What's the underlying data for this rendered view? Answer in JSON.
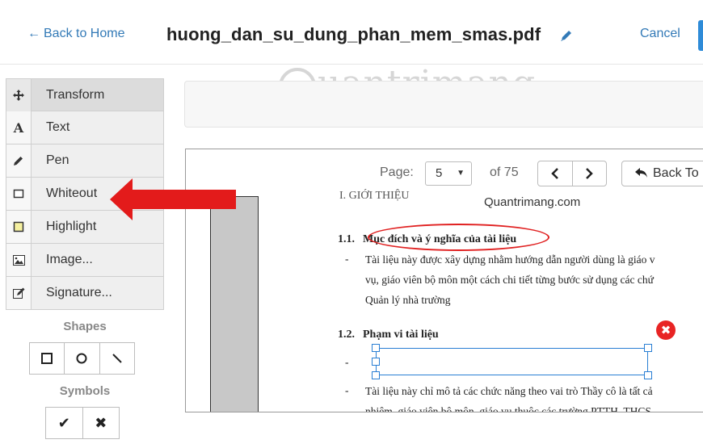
{
  "header": {
    "back_link": "Back to Home",
    "back_arrow": "←",
    "file_name": "huong_dan_su_dung_phan_mem_smas.pdf",
    "cancel": "Cancel",
    "edit_icon": "pencil-icon"
  },
  "tools": [
    {
      "icon": "move-icon",
      "label": "Transform",
      "active": true
    },
    {
      "icon": "text-icon",
      "label": "Text"
    },
    {
      "icon": "pen-icon",
      "label": "Pen"
    },
    {
      "icon": "whiteout-icon",
      "label": "Whiteout"
    },
    {
      "icon": "highlight-icon",
      "label": "Highlight"
    },
    {
      "icon": "image-icon",
      "label": "Image..."
    },
    {
      "icon": "signature-icon",
      "label": "Signature..."
    }
  ],
  "text_icon_glyph": "A",
  "shapes": {
    "title": "Shapes",
    "items": [
      "rectangle-icon",
      "circle-icon",
      "line-icon"
    ]
  },
  "symbols": {
    "title": "Symbols",
    "check": "✔",
    "cross": "✖"
  },
  "watermark": "uantrimang",
  "nav": {
    "page_label": "Page:",
    "page_value": "5",
    "of_pages": "of 75",
    "prev": "‹",
    "next": "›",
    "back_to": "Back To"
  },
  "document": {
    "cut_heading": "I.  GIỚI THIỆU",
    "site_label": "Quantrimang.com",
    "h11_number": "1.1.",
    "h11_title": "Mục đích và ý nghĩa của tài liệu",
    "p1_line1": "Tài liệu này được xây dựng nhằm hướng dẫn người dùng là giáo v",
    "p1_line2": "vụ, giáo viên bộ môn một cách chi tiết từng bước sử dụng các chứ",
    "p1_line3": "Quản lý nhà trường",
    "bullet": "-",
    "h12_number": "1.2.",
    "h12_title": "Phạm vi tài liệu",
    "p2_line1": "Tài liệu này chỉ mô tả các chức năng theo vai trò Thầy cô là tất cả",
    "p2_line2": "nhiệm, giáo viên bộ môn, giáo vụ thuộc các trường PTTH, THCS",
    "delete_glyph": "✖"
  },
  "colors": {
    "link": "#337ab7",
    "arrow_red": "#e31b1b",
    "selection_blue": "#2a7fd4"
  }
}
